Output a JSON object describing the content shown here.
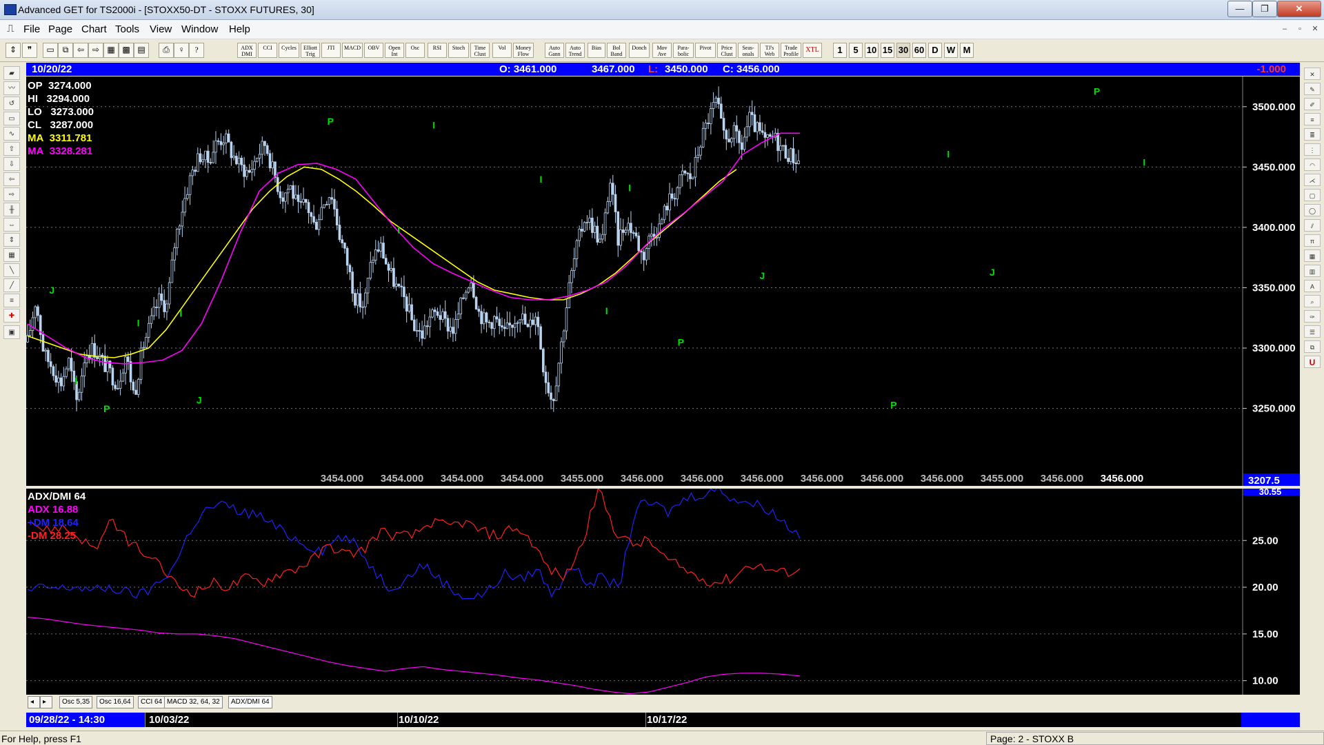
{
  "window": {
    "title": "Advanced GET for TS2000i - [STOXX50-DT - STOXX FUTURES, 30]",
    "min": "—",
    "max": "❐",
    "close": "✕",
    "mdi_min": "–",
    "mdi_restore": "▫",
    "mdi_close": "✕"
  },
  "menu": [
    "File",
    "Page",
    "Chart",
    "Tools",
    "View",
    "Window",
    "Help"
  ],
  "toolbar": {
    "indicator_buttons": [
      "ADX DMI",
      "CCI",
      "Cycles",
      "Elliott Trig",
      "JTI",
      "MACD",
      "OBV",
      "Open Int",
      "Osc",
      "RSI",
      "Stoch",
      "Time Clust",
      "Vol",
      "Money Flow",
      "Auto Gann",
      "Auto Trend",
      "Bias",
      "Bol Band",
      "Donch",
      "Mov Ave",
      "Para- bolic",
      "Pivot",
      "Price Clust",
      "Seas- onals",
      "TJ's Web",
      "Trade Profile",
      "XTL"
    ],
    "period_buttons": [
      "1",
      "5",
      "10",
      "15",
      "30",
      "60",
      "D",
      "W",
      "M"
    ]
  },
  "infobar": {
    "date": "10/20/22",
    "open": "O: 3461.000",
    "high": "3467.000",
    "low_label": "L:",
    "low": "3450.000",
    "close": "C: 3456.000",
    "change": "-1.000"
  },
  "price_legend": [
    {
      "label": "OP",
      "value": "3274.000",
      "color": "#ffffff"
    },
    {
      "label": "HI",
      "value": "3294.000",
      "color": "#ffffff"
    },
    {
      "label": "LO",
      "value": "3273.000",
      "color": "#ffffff"
    },
    {
      "label": "CL",
      "value": "3287.000",
      "color": "#ffffff"
    },
    {
      "label": "MA",
      "value": "3311.781",
      "color": "#ffff00"
    },
    {
      "label": "MA",
      "value": "3328.281",
      "color": "#ff00ff"
    }
  ],
  "price_row": [
    "3454.000",
    "3454.000",
    "3454.000",
    "3454.000",
    "3455.000",
    "3456.000",
    "3456.000",
    "3456.000",
    "3456.000",
    "3456.000",
    "3456.000",
    "3455.000",
    "3456.000",
    "3456.000"
  ],
  "price_row_corner": "3207.5",
  "indicator_legend": [
    {
      "label": "ADX/DMI 64",
      "color": "#ffffff"
    },
    {
      "label": "ADX 16.88",
      "color": "#ff00ff"
    },
    {
      "label": "+DM 18.64",
      "color": "#2020ff"
    },
    {
      "label": "-DM  28.25",
      "color": "#ff2020"
    }
  ],
  "indicator_axis_top": "30.55",
  "tabs": [
    "Osc 5,35",
    "Osc 16,64",
    "CCI 64",
    "MACD 32, 64, 32",
    "ADX/DMI 64"
  ],
  "datebar": {
    "first": "09/28/22 - 14:30",
    "dates": [
      "10/03/22",
      "10/10/22",
      "10/17/22"
    ]
  },
  "status": {
    "left": "For Help, press F1",
    "right": "Page: 2 - STOXX B"
  },
  "colors": {
    "accent": "#0000ff",
    "candle": "#b8d4f0",
    "ma_fast": "#ffff00",
    "ma_slow": "#ff00ff",
    "pivot": "#00e000"
  },
  "chart_data": [
    {
      "type": "candlestick",
      "title": "STOXX50-DT - STOXX FUTURES, 30",
      "ylim": [
        3207.5,
        3525
      ],
      "yticks": [
        3250,
        3300,
        3350,
        3400,
        3450,
        3500
      ],
      "ytick_labels": [
        "3250.000",
        "3300.000",
        "3350.000",
        "3400.000",
        "3450.000",
        "3500.000"
      ],
      "x_dates": [
        "10/03/22",
        "10/10/22",
        "10/17/22"
      ],
      "close_path": [
        3305,
        3340,
        3295,
        3285,
        3270,
        3290,
        3255,
        3295,
        3300,
        3290,
        3280,
        3270,
        3295,
        3260,
        3300,
        3320,
        3340,
        3335,
        3390,
        3420,
        3445,
        3460,
        3455,
        3470,
        3475,
        3460,
        3450,
        3445,
        3460,
        3470,
        3445,
        3425,
        3435,
        3415,
        3420,
        3400,
        3420,
        3430,
        3395,
        3370,
        3340,
        3335,
        3375,
        3385,
        3365,
        3350,
        3340,
        3320,
        3310,
        3325,
        3330,
        3320,
        3315,
        3340,
        3360,
        3330,
        3320,
        3325,
        3310,
        3320,
        3330,
        3315,
        3330,
        3280,
        3255,
        3300,
        3350,
        3385,
        3410,
        3400,
        3385,
        3440,
        3390,
        3405,
        3395,
        3375,
        3395,
        3400,
        3420,
        3430,
        3445,
        3440,
        3470,
        3490,
        3505,
        3470,
        3480,
        3465,
        3490,
        3480,
        3470,
        3475,
        3465,
        3460,
        3455
      ],
      "series": [
        {
          "name": "MA 3311.781",
          "values": [
            3310,
            3305,
            3300,
            3295,
            3293,
            3292,
            3295,
            3300,
            3315,
            3335,
            3355,
            3375,
            3395,
            3415,
            3430,
            3442,
            3450,
            3448,
            3440,
            3430,
            3418,
            3405,
            3395,
            3385,
            3375,
            3365,
            3355,
            3348,
            3345,
            3342,
            3340,
            3340,
            3345,
            3352,
            3362,
            3375,
            3388,
            3400,
            3412,
            3425,
            3438,
            3448
          ]
        },
        {
          "name": "MA 3328.281",
          "values": [
            3320,
            3310,
            3300,
            3292,
            3288,
            3287,
            3288,
            3290,
            3298,
            3320,
            3355,
            3395,
            3430,
            3445,
            3452,
            3453,
            3448,
            3440,
            3420,
            3400,
            3383,
            3370,
            3362,
            3355,
            3348,
            3342,
            3340,
            3340,
            3343,
            3348,
            3355,
            3368,
            3385,
            3400,
            3412,
            3425,
            3438,
            3460,
            3470,
            3478,
            3478
          ]
        }
      ],
      "pivot_labels": [
        {
          "label": "J",
          "x": 0.02,
          "y": 3345
        },
        {
          "label": "I",
          "x": 0.04,
          "y": 3270
        },
        {
          "label": "P",
          "x": 0.065,
          "y": 3247
        },
        {
          "label": "I",
          "x": 0.091,
          "y": 3318
        },
        {
          "label": "I",
          "x": 0.126,
          "y": 3326
        },
        {
          "label": "J",
          "x": 0.141,
          "y": 3254
        },
        {
          "label": "P",
          "x": 0.249,
          "y": 3485
        },
        {
          "label": "I",
          "x": 0.305,
          "y": 3395
        },
        {
          "label": "I",
          "x": 0.334,
          "y": 3482
        },
        {
          "label": "I",
          "x": 0.422,
          "y": 3437
        },
        {
          "label": "I",
          "x": 0.476,
          "y": 3328
        },
        {
          "label": "I",
          "x": 0.495,
          "y": 3430
        },
        {
          "label": "P",
          "x": 0.537,
          "y": 3302
        },
        {
          "label": "J",
          "x": 0.604,
          "y": 3357
        },
        {
          "label": "P",
          "x": 0.712,
          "y": 3250
        },
        {
          "label": "I",
          "x": 0.757,
          "y": 3458
        },
        {
          "label": "J",
          "x": 0.793,
          "y": 3360
        },
        {
          "label": "P",
          "x": 0.879,
          "y": 3510
        },
        {
          "label": "I",
          "x": 0.918,
          "y": 3451
        }
      ]
    },
    {
      "type": "line",
      "title": "ADX/DMI 64",
      "ylim": [
        8.5,
        30.55
      ],
      "yticks": [
        10,
        15,
        20,
        25
      ],
      "ytick_labels": [
        "10.00",
        "15.00",
        "20.00",
        "25.00"
      ],
      "series": [
        {
          "name": "ADX 16.88",
          "values": [
            16.8,
            16.6,
            16.3,
            16.0,
            15.8,
            15.6,
            15.4,
            15.1,
            15.0,
            15.0,
            14.8,
            14.5,
            14.0,
            13.5,
            13.0,
            12.5,
            12.0,
            11.6,
            11.3,
            11.0,
            11.3,
            11.5,
            11.2,
            11.0,
            10.8,
            10.6,
            10.3,
            10.1,
            9.8,
            9.5,
            9.1,
            8.8,
            8.6,
            8.8,
            9.3,
            9.8,
            10.4,
            10.7,
            10.8,
            10.8,
            10.7,
            10.5
          ]
        },
        {
          "name": "+DM 18.64",
          "values": [
            19.5,
            20.0,
            19.8,
            20.1,
            19.6,
            20.0,
            19.4,
            19.2,
            20.5,
            22.5,
            26.5,
            28.5,
            28.8,
            28.0,
            27.8,
            26.5,
            25.5,
            24.5,
            24.0,
            25.5,
            24.5,
            22.0,
            20.0,
            20.8,
            22.5,
            21.0,
            19.5,
            18.8,
            19.5,
            21.5,
            20.8,
            22.0,
            19.0,
            22.5,
            20.5,
            21.0,
            20.0,
            28.5,
            29.0,
            28.0,
            29.5,
            30.0,
            30.5,
            29.5,
            29.0,
            28.5,
            27.0,
            25.5
          ]
        },
        {
          "name": "-DM  28.25",
          "values": [
            27.5,
            26.0,
            26.5,
            25.5,
            24.0,
            27.0,
            25.0,
            23.5,
            22.0,
            20.0,
            19.5,
            20.5,
            20.0,
            21.0,
            20.5,
            21.5,
            22.0,
            23.0,
            24.5,
            23.5,
            24.0,
            26.0,
            25.5,
            25.5,
            27.0,
            26.5,
            27.0,
            26.0,
            25.5,
            26.5,
            25.0,
            22.0,
            21.0,
            24.5,
            30.5,
            26.0,
            24.5,
            25.0,
            23.0,
            22.0,
            21.0,
            20.5,
            21.0,
            22.5,
            22.0,
            21.5,
            22.0
          ]
        }
      ]
    }
  ]
}
